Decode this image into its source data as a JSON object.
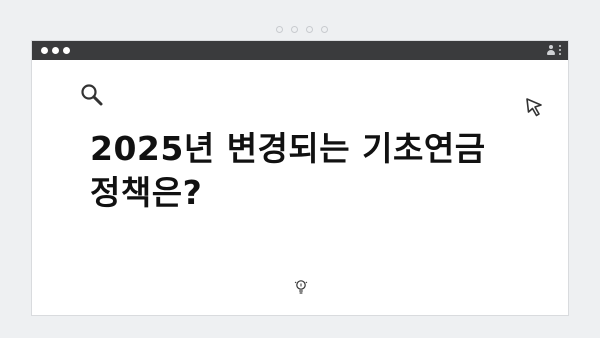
{
  "top_pager": {
    "dot_count": 4
  },
  "window": {
    "titlebar_color": "#3a3b3d",
    "traffic_lights": [
      "dot",
      "dot",
      "dot"
    ],
    "right_icons": [
      "user-icon",
      "kebab-menu-icon"
    ]
  },
  "icons": {
    "search": "search-icon",
    "cursor": "cursor-pointer-icon",
    "bulb": "lightbulb-icon"
  },
  "headline": {
    "line1": "2025년 변경되는 기초연금",
    "line2": "정책은?"
  }
}
